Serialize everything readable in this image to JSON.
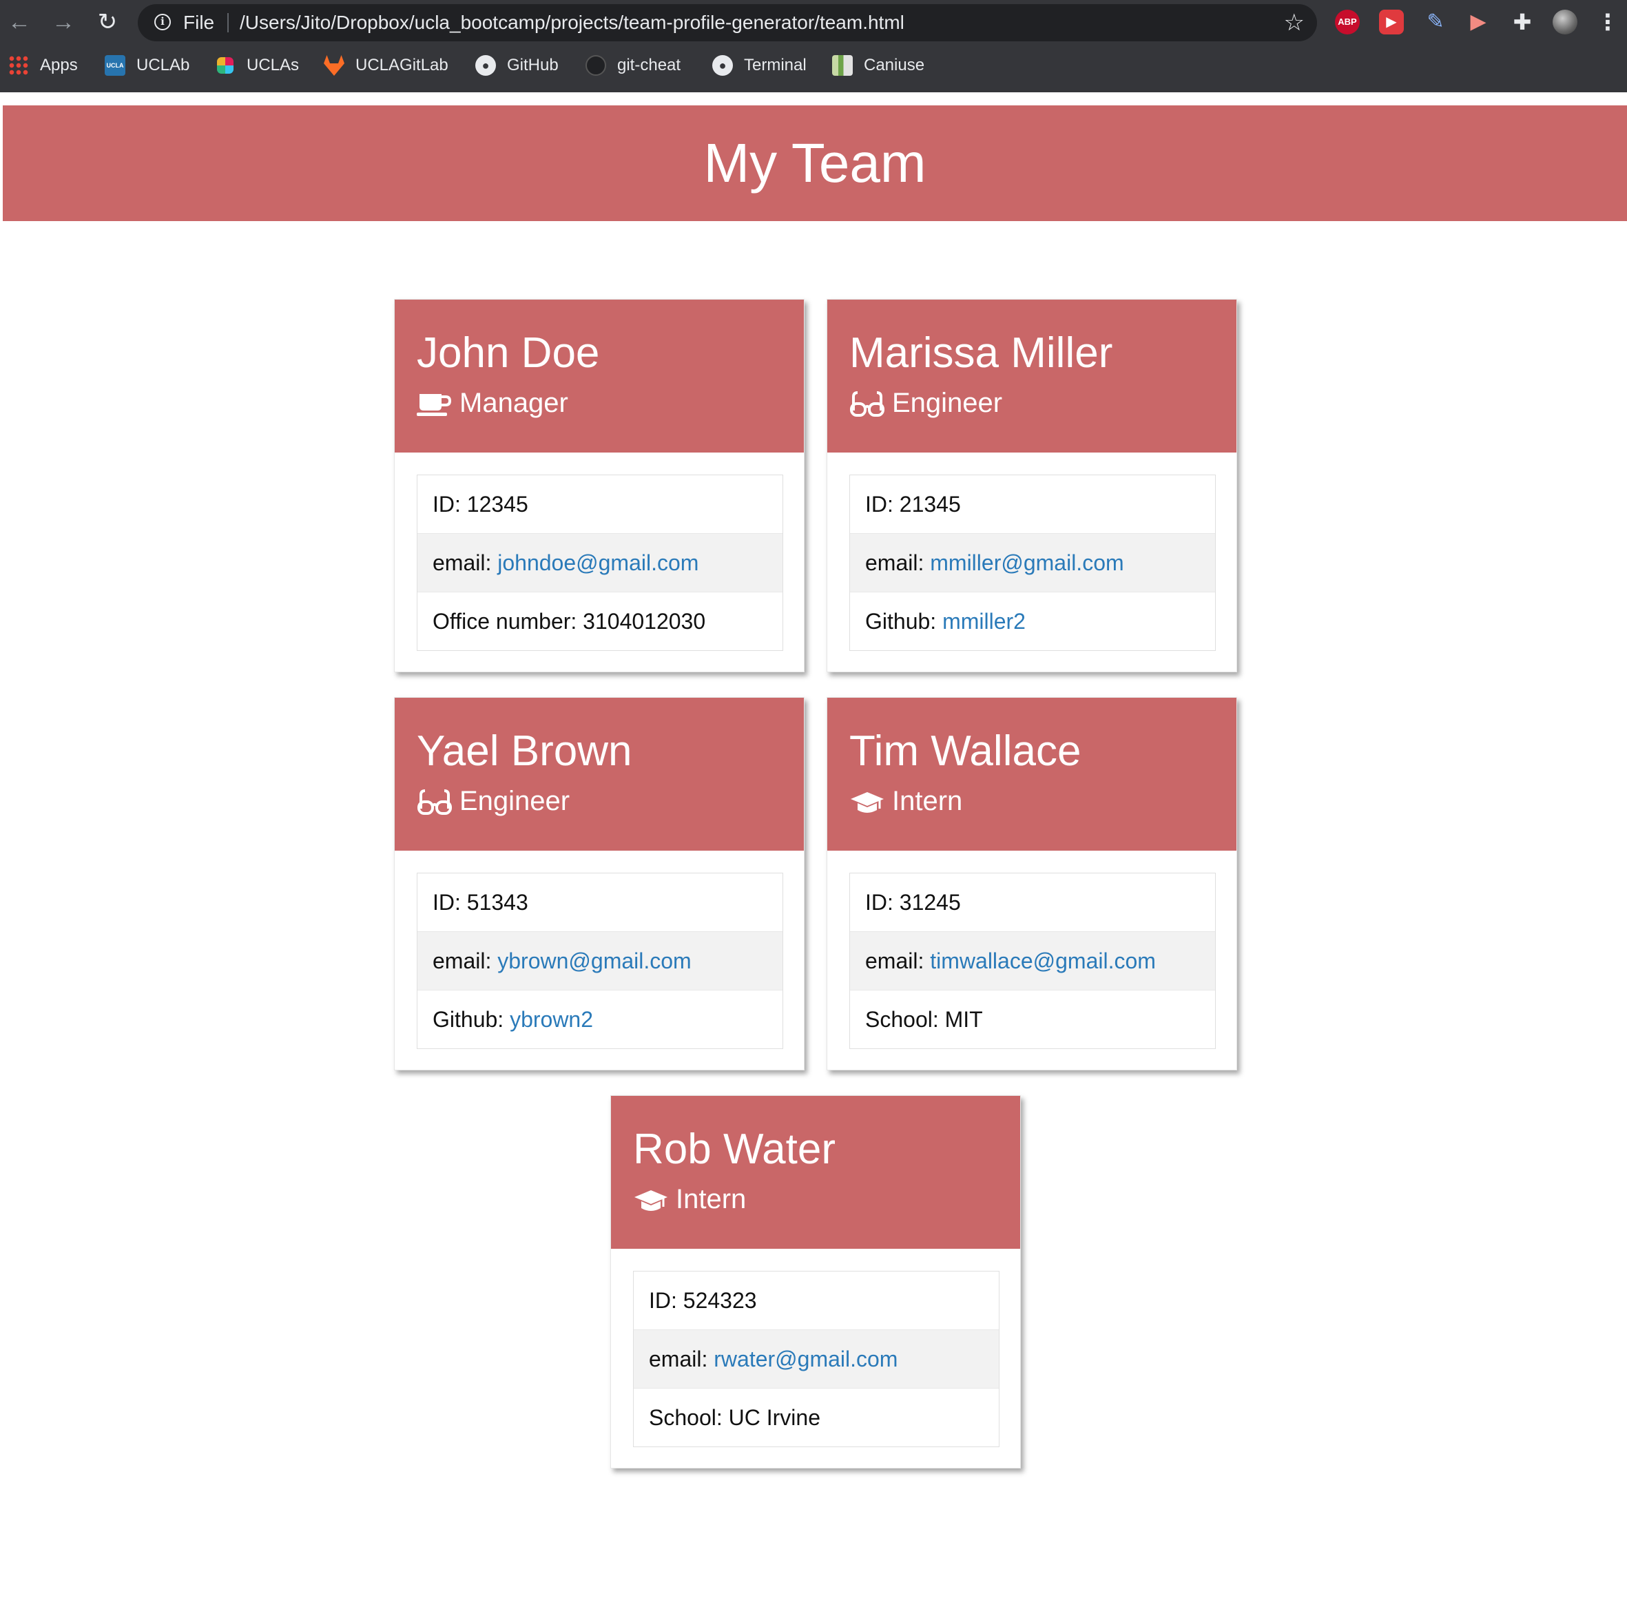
{
  "browser": {
    "scheme_label": "File",
    "url": "/Users/Jito/Dropbox/ucla_bootcamp/projects/team-profile-generator/team.html",
    "nav": {
      "back": "←",
      "forward": "→",
      "reload": "↻"
    },
    "extensions": {
      "abp_label": "ABP"
    },
    "bookmarks": [
      {
        "label": "Apps",
        "icon": "apps-grid-icon"
      },
      {
        "label": "UCLAb",
        "icon": "ucla-icon"
      },
      {
        "label": "UCLAs",
        "icon": "slack-icon"
      },
      {
        "label": "UCLAGitLab",
        "icon": "gitlab-icon"
      },
      {
        "label": "GitHub",
        "icon": "github-icon"
      },
      {
        "label": "git-cheat",
        "icon": "github-icon"
      },
      {
        "label": "Terminal",
        "icon": "github-icon"
      },
      {
        "label": "Caniuse",
        "icon": "caniuse-icon"
      }
    ]
  },
  "page": {
    "title": "My Team"
  },
  "team": [
    {
      "name": "John Doe",
      "role": "Manager",
      "role_icon": "coffee-mug-icon",
      "id_label": "ID: ",
      "id": "12345",
      "email_label": "email: ",
      "email": "johndoe@gmail.com",
      "extra_label": "Office number: ",
      "extra_value": "3104012030"
    },
    {
      "name": "Marissa Miller",
      "role": "Engineer",
      "role_icon": "glasses-icon",
      "id_label": "ID: ",
      "id": "21345",
      "email_label": "email: ",
      "email": "mmiller@gmail.com",
      "extra_label": "Github: ",
      "extra_value": "mmiller2"
    },
    {
      "name": "Yael Brown",
      "role": "Engineer",
      "role_icon": "glasses-icon",
      "id_label": "ID: ",
      "id": "51343",
      "email_label": "email: ",
      "email": "ybrown@gmail.com",
      "extra_label": "Github: ",
      "extra_value": "ybrown2"
    },
    {
      "name": "Tim Wallace",
      "role": "Intern",
      "role_icon": "graduation-cap-icon",
      "id_label": "ID: ",
      "id": "31245",
      "email_label": "email: ",
      "email": "timwallace@gmail.com",
      "extra_label": "School: ",
      "extra_value": "MIT"
    },
    {
      "name": "Rob Water",
      "role": "Intern",
      "role_icon": "graduation-cap-icon",
      "id_label": "ID: ",
      "id": "524323",
      "email_label": "email: ",
      "email": "rwater@gmail.com",
      "extra_label": "School: ",
      "extra_value": "UC Irvine"
    }
  ],
  "colors": {
    "header": "#c96768",
    "link": "#2a7ab9",
    "chrome": "#35363a"
  }
}
